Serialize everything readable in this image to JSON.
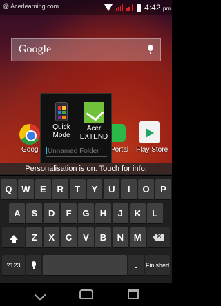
{
  "status_bar": {
    "notification_text": "@ Acerlearning.com",
    "time": "4:42",
    "ampm": "pm"
  },
  "search_bar": {
    "brand": "Google"
  },
  "home_apps": [
    {
      "label": "Googl"
    },
    {
      "label": "Portal"
    },
    {
      "label": "Play Store"
    }
  ],
  "folder": {
    "apps": [
      {
        "label_line1": "Quick",
        "label_line2": "Mode"
      },
      {
        "label_line1": "Acer",
        "label_line2": "EXTEND"
      }
    ],
    "name_placeholder": "Unnamed Folder"
  },
  "banner": {
    "text": "Personalisation is on. Touch for info."
  },
  "keyboard": {
    "row1": [
      "Q",
      "W",
      "E",
      "R",
      "T",
      "Y",
      "U",
      "I",
      "O",
      "P"
    ],
    "row2": [
      "A",
      "S",
      "D",
      "F",
      "G",
      "H",
      "J",
      "K",
      "L"
    ],
    "row3": [
      "Z",
      "X",
      "C",
      "V",
      "B",
      "N",
      "M"
    ],
    "symbols_label": "?123",
    "period": ".",
    "enter_label": "Finished"
  }
}
